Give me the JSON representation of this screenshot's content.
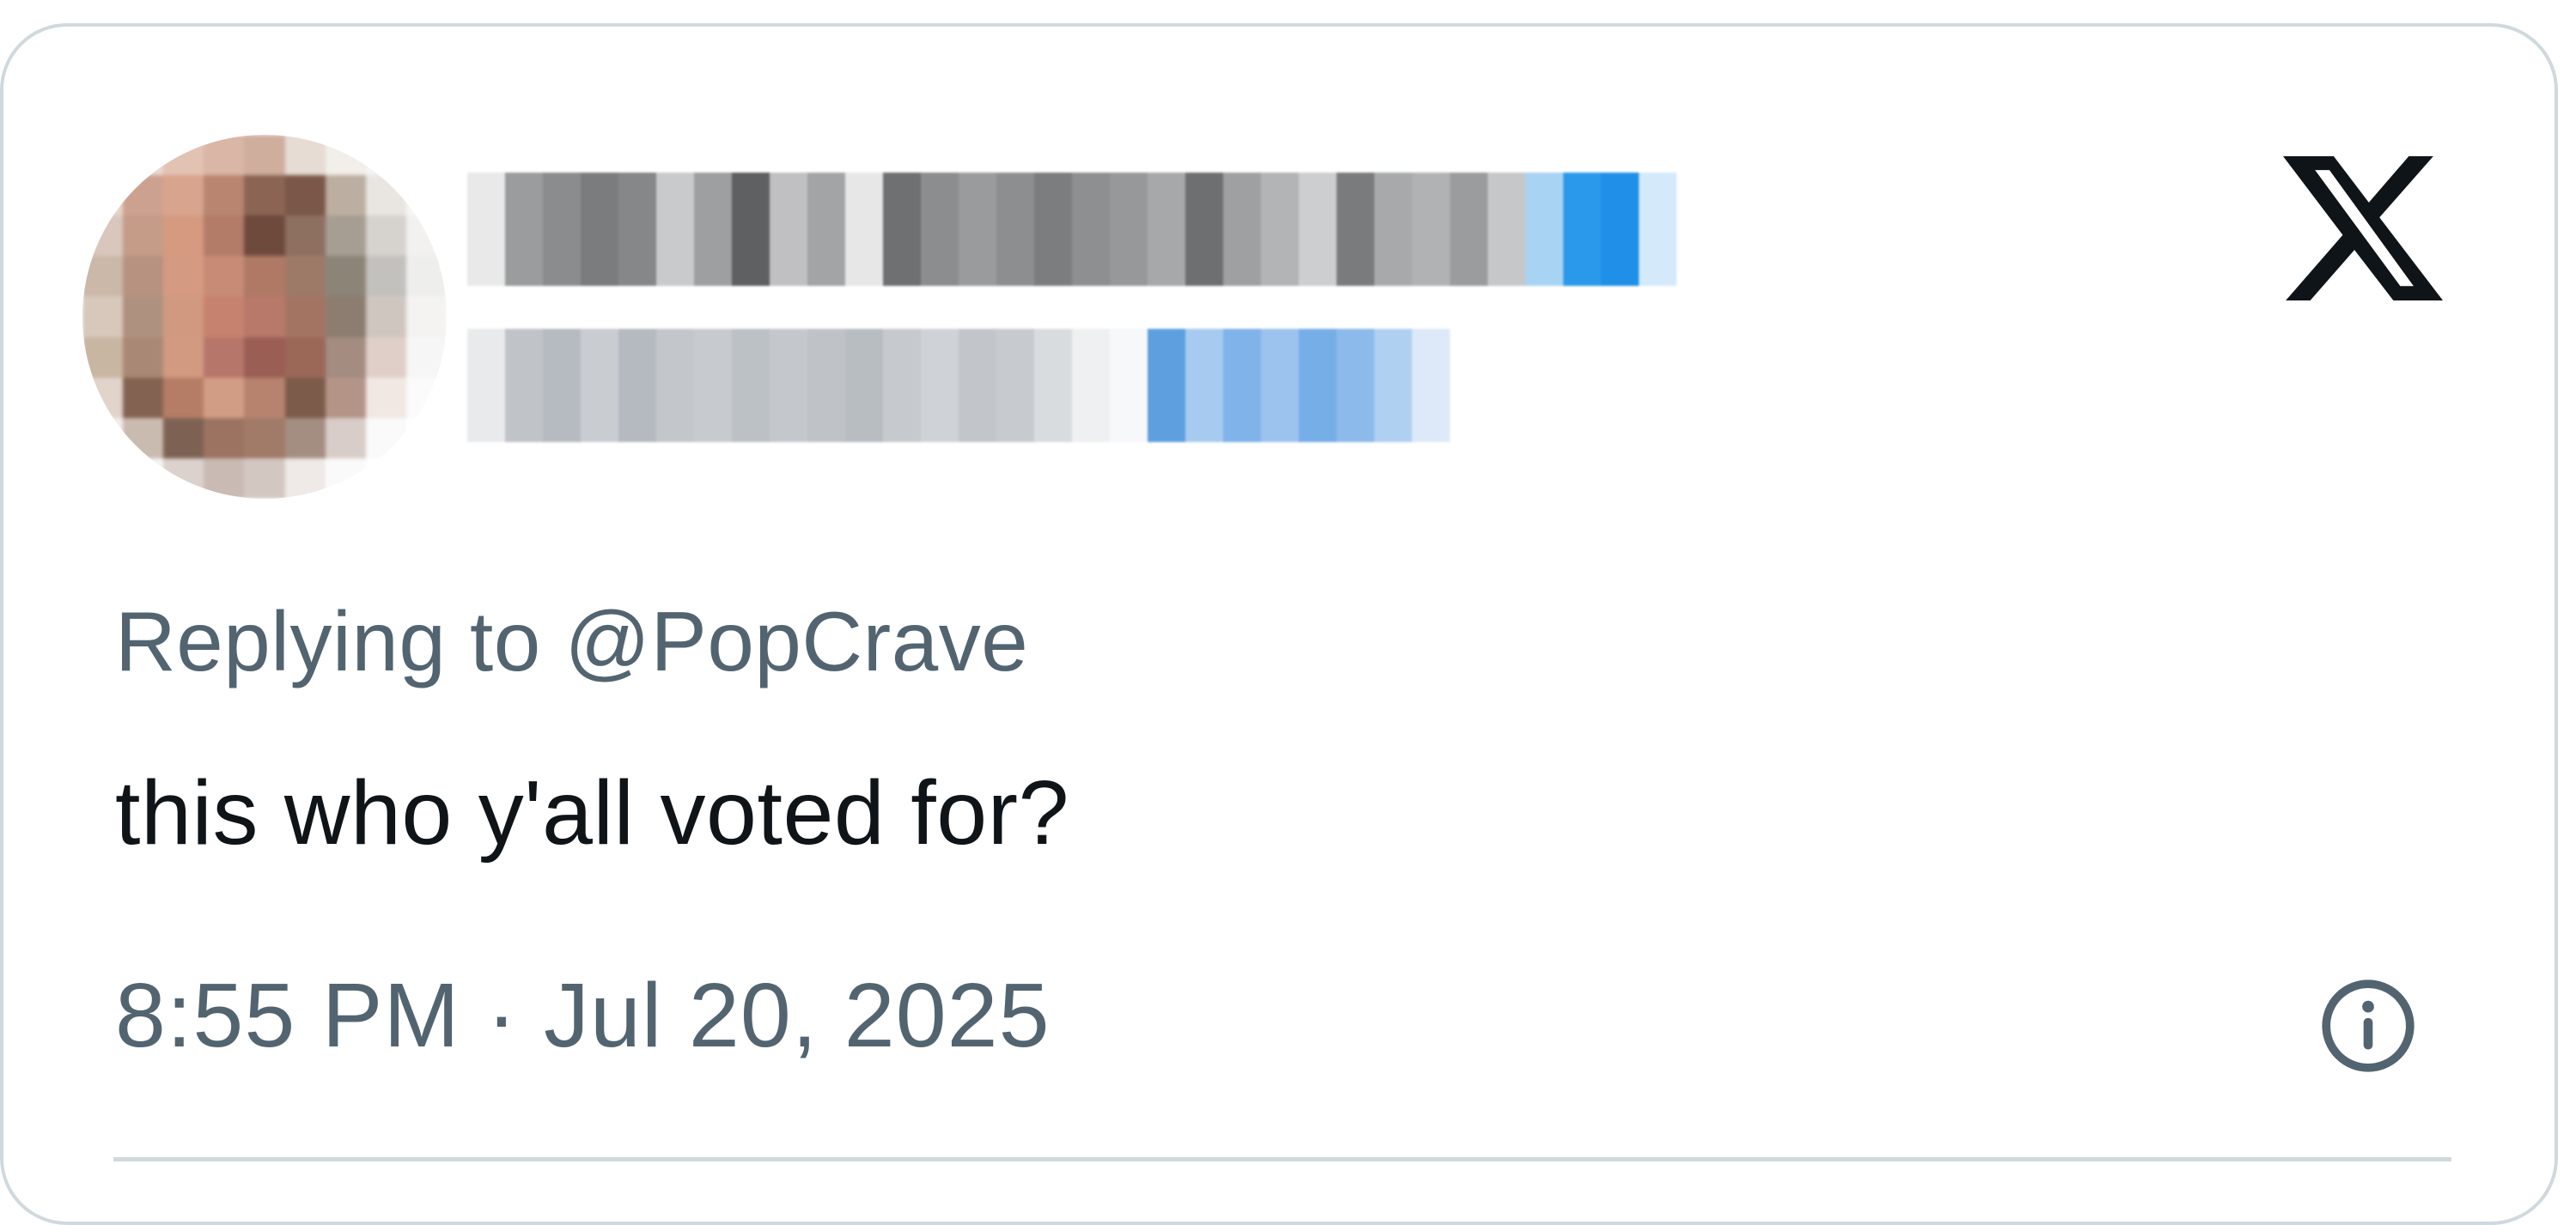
{
  "tweet": {
    "reply_prefix": "Replying to",
    "reply_handle": "@PopCrave",
    "text": "this who y'all voted for?",
    "time": "8:55 PM",
    "separator": "·",
    "date": "Jul 20, 2025"
  },
  "icons": {
    "brand_logo": "x-logo-icon",
    "info": "info-icon"
  },
  "colors": {
    "secondary_text": "#536471",
    "primary_text": "#0f1419",
    "border": "#cfd9de",
    "verified_blue": "#1d9bf0"
  }
}
